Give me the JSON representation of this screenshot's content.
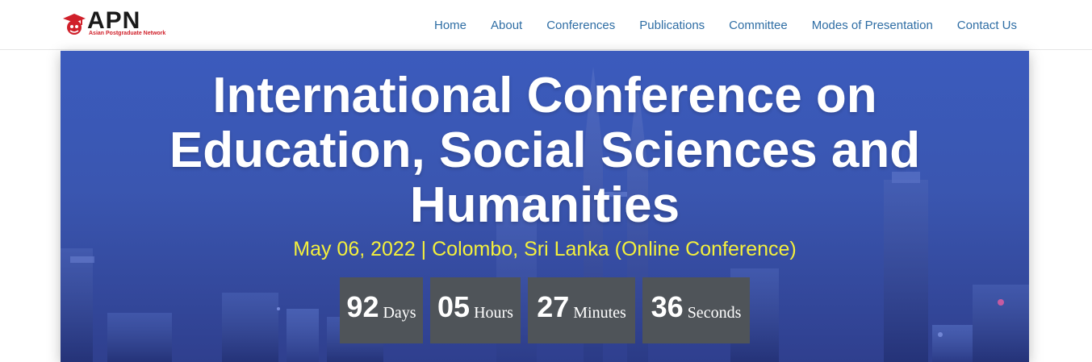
{
  "brand": {
    "name": "APN",
    "tagline": "Asian Postgraduate Network",
    "accent_color": "#d0202a"
  },
  "nav": {
    "items": [
      "Home",
      "About",
      "Conferences",
      "Publications",
      "Committee",
      "Modes of Presentation",
      "Contact Us"
    ],
    "link_color": "#2e6da4"
  },
  "hero": {
    "title_line1": "International Conference on",
    "title_line2": "Education, Social Sciences and",
    "title_line3": "Humanities",
    "subtitle": "May 06, 2022 | Colombo, Sri Lanka (Online Conference)",
    "subtitle_color": "#f4f03c"
  },
  "countdown": {
    "days": "92",
    "days_label": "Days",
    "hours": "05",
    "hours_label": "Hours",
    "minutes": "27",
    "minutes_label": "Minutes",
    "seconds": "36",
    "seconds_label": "Seconds"
  }
}
